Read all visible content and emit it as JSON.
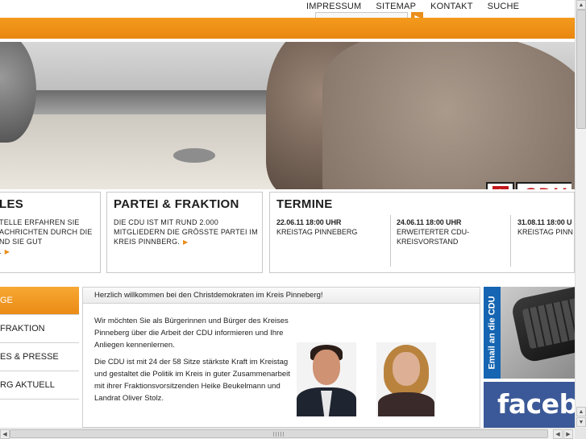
{
  "topnav": {
    "items": [
      "IMPRESSUM",
      "SITEMAP",
      "KONTAKT",
      "SUCHE"
    ]
  },
  "search": {
    "value": "",
    "go_icon": "arrow-right-icon"
  },
  "colors": {
    "accent": "#e98d1c",
    "cdu_red": "#c4161c",
    "email_blue": "#1565b2",
    "facebook_blue": "#3b5998"
  },
  "logo": {
    "text": "CDU"
  },
  "boxes": {
    "box1": {
      "title": "LES",
      "text": "TELLE ERFAHREN SIE\nACHRICHTEN DURCH DIE\nND SIE GUT\n."
    },
    "box2": {
      "title": "PARTEI & FRAKTION",
      "text": "DIE CDU IST MIT RUND 2.000 MITGLIEDERN DIE GRÖSSTE PARTEI IM KREIS PINNBERG."
    },
    "box3": {
      "title": "TERMINE",
      "items": [
        {
          "date": "22.06.11 18:00 UHR",
          "desc": "KREISTAG PINNEBERG"
        },
        {
          "date": "24.06.11 18:00 UHR",
          "desc": "ERWEITERTER CDU-KREISVORSTAND"
        },
        {
          "date": "31.08.11 18:00 U",
          "desc": "KREISTAG PINN"
        }
      ]
    }
  },
  "leftnav": {
    "items": [
      "GE",
      "FRAKTION",
      "ES & PRESSE",
      "RG AKTUELL"
    ]
  },
  "content": {
    "welcome": "Herzlich willkommen bei den Christdemokraten im Kreis Pinneberg!",
    "paragraph1": "Wir möchten Sie als Bürgerinnen und Bürger des Kreises Pinneberg über die Arbeit der CDU informieren und Ihre Anliegen kennenlernen.",
    "paragraph2": "Die CDU ist mit 24 der 58 Sitze stärkste Kraft im Kreistag und gestaltet die Politik im Kreis in guter Zusammenarbeit mit ihrer Fraktionsvorsitzenden Heike Beukelmann und Landrat Oliver Stolz."
  },
  "banners": {
    "email": "Email an die CDU",
    "facebook": "facebo"
  },
  "scrollbars": {
    "up_icon": "▲",
    "down_icon": "▼",
    "left_icon": "◀",
    "right_icon": "▶"
  }
}
